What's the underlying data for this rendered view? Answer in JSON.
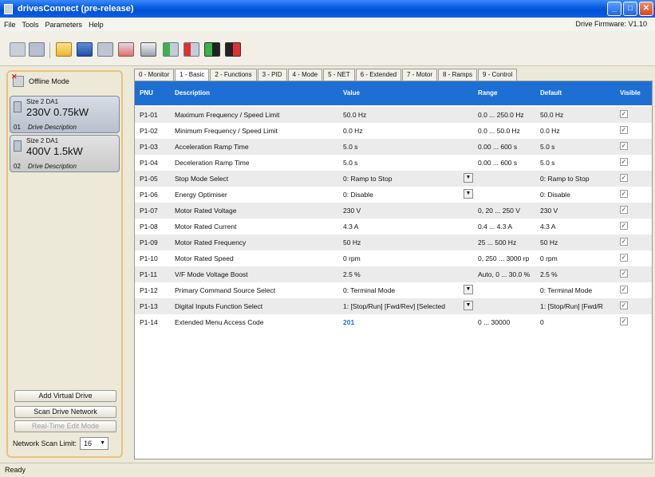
{
  "window": {
    "title": "drivesConnect (pre-release)"
  },
  "menu": {
    "items": [
      "File",
      "Tools",
      "Parameters",
      "Help"
    ],
    "firmware": "Drive Firmware: V1.10"
  },
  "left_panel": {
    "offline_label": "Offline Mode",
    "drives": [
      {
        "size": "Size 2  DA1",
        "rating": "230V 0.75kW",
        "num": "01",
        "desc": "Drive Description"
      },
      {
        "size": "Size 2  DA1",
        "rating": "400V 1.5kW",
        "num": "02",
        "desc": "Drive Description"
      }
    ],
    "buttons": {
      "add": "Add Virtual Drive",
      "scan": "Scan Drive Network",
      "realtime": "Real-Time Edit Mode"
    },
    "scan_limit_label": "Network Scan Limit:",
    "scan_limit_value": "16"
  },
  "tabs": [
    "0 - Monitor",
    "1 - Basic",
    "2 - Functions",
    "3 - PID",
    "4 - Mode",
    "5 - NET",
    "6 - Extended",
    "7 - Motor",
    "8 - Ramps",
    "9 - Control"
  ],
  "grid": {
    "headers": {
      "pnu": "PNU",
      "desc": "Description",
      "value": "Value",
      "range": "Range",
      "default": "Default",
      "visible": "Visible"
    },
    "rows": [
      {
        "pnu": "P1-01",
        "desc": "Maximum Frequency / Speed Limit",
        "value": "50.0 Hz",
        "range": "0.0 ... 250.0 Hz",
        "default": "50.0 Hz"
      },
      {
        "pnu": "P1-02",
        "desc": "Minimum Frequency / Speed Limit",
        "value": "0.0 Hz",
        "range": "0.0 ... 50.0 Hz",
        "default": "0.0 Hz"
      },
      {
        "pnu": "P1-03",
        "desc": "Acceleration Ramp Time",
        "value": "5.0 s",
        "range": "0.00 ... 600 s",
        "default": "5.0 s"
      },
      {
        "pnu": "P1-04",
        "desc": "Deceleration Ramp Time",
        "value": "5.0 s",
        "range": "0.00 ... 600 s",
        "default": "5.0 s"
      },
      {
        "pnu": "P1-05",
        "desc": "Stop Mode Select",
        "value": "0: Ramp to Stop",
        "range": "",
        "default": "0: Ramp to Stop"
      },
      {
        "pnu": "P1-06",
        "desc": "Energy Optimiser",
        "value": "0: Disable",
        "range": "",
        "default": "0: Disable"
      },
      {
        "pnu": "P1-07",
        "desc": "Motor Rated Voltage",
        "value": "230 V",
        "range": "0, 20 ... 250 V",
        "default": "230 V"
      },
      {
        "pnu": "P1-08",
        "desc": "Motor Rated Current",
        "value": "4.3 A",
        "range": "0.4 ... 4.3 A",
        "default": "4.3 A"
      },
      {
        "pnu": "P1-09",
        "desc": "Motor Rated Frequency",
        "value": "50 Hz",
        "range": "25 ... 500 Hz",
        "default": "50 Hz"
      },
      {
        "pnu": "P1-10",
        "desc": "Motor Rated Speed",
        "value": "0 rpm",
        "range": "0, 250 ... 3000 rp",
        "default": "0 rpm"
      },
      {
        "pnu": "P1-11",
        "desc": "V/F Mode Voltage Boost",
        "value": "2.5 %",
        "range": "Auto, 0 ... 30.0 %",
        "default": "2.5 %"
      },
      {
        "pnu": "P1-12",
        "desc": "Primary Command Source Select",
        "value": "0: Terminal Mode",
        "range": "",
        "default": "0: Terminal Mode"
      },
      {
        "pnu": "P1-13",
        "desc": "Digital Inputs Function Select",
        "value": "1: [Stop/Run] [Fwd/Rev] [Selected",
        "range": "",
        "default": "1: [Stop/Run] [Fwd/R"
      },
      {
        "pnu": "P1-14",
        "desc": "Extended Menu Access Code",
        "value": "201",
        "range": "0 ... 30000",
        "default": "0"
      }
    ]
  },
  "status": "Ready"
}
